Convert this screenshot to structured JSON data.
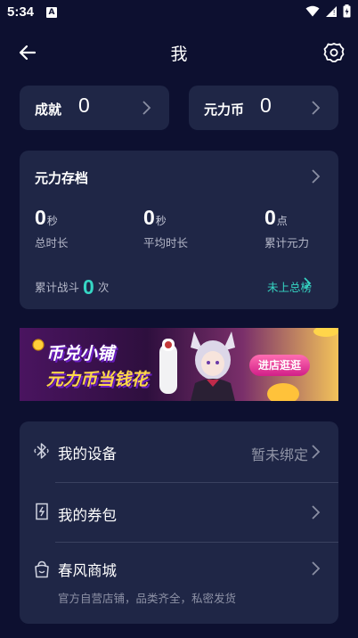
{
  "status": {
    "time": "5:34",
    "notification_badge": "A"
  },
  "header": {
    "title": "我"
  },
  "stats": {
    "achievement": {
      "label": "成就",
      "value": "0"
    },
    "coin": {
      "label": "元力币",
      "value": "0"
    }
  },
  "archive": {
    "title": "元力存档",
    "metrics": [
      {
        "value": "0",
        "unit": "秒",
        "label": "总时长"
      },
      {
        "value": "0",
        "unit": "秒",
        "label": "平均时长"
      },
      {
        "value": "0",
        "unit": "点",
        "label": "累计元力"
      }
    ],
    "battle_prefix": "累计战斗",
    "battle_count": "0",
    "battle_suffix": "次",
    "rank_link": "未上总榜"
  },
  "banner": {
    "line1": "币兑小铺",
    "line2": "元力币当钱花",
    "cta": "进店逛逛"
  },
  "menu": {
    "device": {
      "label": "我的设备",
      "value": "暂未绑定",
      "icon": "bluetooth-icon"
    },
    "coupons": {
      "label": "我的券包",
      "icon": "coupon-icon"
    },
    "store": {
      "label": "春风商城",
      "subtitle": "官方自营店铺，品类齐全，私密发货",
      "icon": "shop-bag-icon"
    }
  },
  "colors": {
    "background": "#0d1030",
    "card": "#1f2646",
    "accent": "#36d6c4"
  }
}
